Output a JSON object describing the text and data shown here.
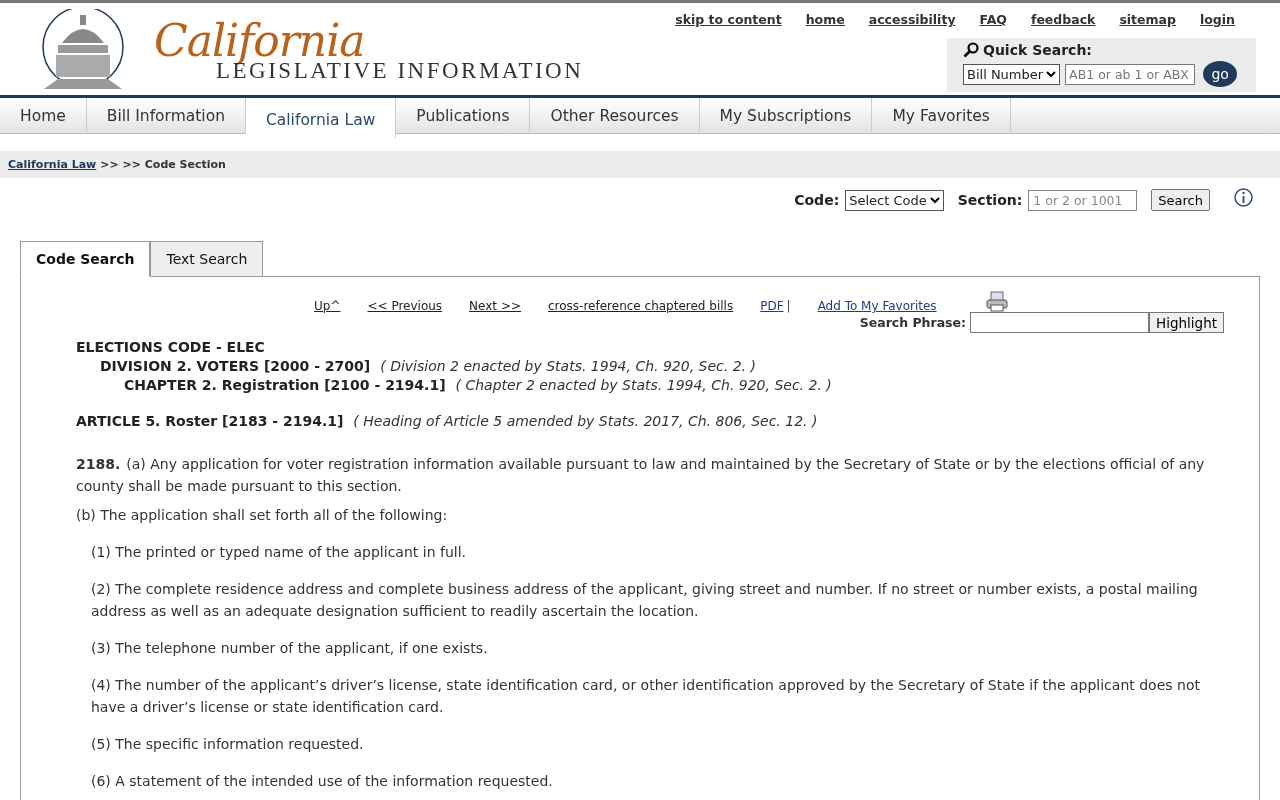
{
  "header": {
    "logo_script": "California",
    "logo_subtitle": "LEGISLATIVE INFORMATION",
    "utility_links": [
      "skip to content",
      "home",
      "accessibility",
      "FAQ",
      "feedback",
      "sitemap",
      "login"
    ],
    "quick_search": {
      "title": "Quick Search:",
      "select_value": "Bill Number",
      "placeholder": "AB1 or ab 1 or ABX",
      "button": "go"
    }
  },
  "nav": [
    {
      "label": "Home",
      "selected": false
    },
    {
      "label": "Bill Information",
      "selected": false
    },
    {
      "label": "California Law",
      "selected": true
    },
    {
      "label": "Publications",
      "selected": false
    },
    {
      "label": "Other Resources",
      "selected": false
    },
    {
      "label": "My Subscriptions",
      "selected": false
    },
    {
      "label": "My Favorites",
      "selected": false
    }
  ],
  "breadcrumb": {
    "link": "California Law",
    "rest": ">> >> Code Section"
  },
  "code_search": {
    "code_label": "Code:",
    "code_select": "Select Code",
    "section_label": "Section:",
    "section_placeholder": "1 or 2 or 1001",
    "button": "Search"
  },
  "tabs": [
    {
      "label": "Code Search",
      "selected": true
    },
    {
      "label": "Text Search",
      "selected": false
    }
  ],
  "doc_links": [
    {
      "label": "Up^",
      "kind": "plain"
    },
    {
      "label": "<< Previous",
      "kind": "plain"
    },
    {
      "label": "Next >>",
      "kind": "plain"
    },
    {
      "label": "cross-reference chaptered bills",
      "kind": "plain"
    },
    {
      "label": "PDF",
      "kind": "blue"
    },
    {
      "label": "Add To My Favorites",
      "kind": "blue"
    }
  ],
  "doc_separator": "|",
  "phrase_search": {
    "label": "Search Phrase:",
    "button": "Highlight"
  },
  "headings": [
    {
      "title": "ELECTIONS CODE - ELEC",
      "children": [
        {
          "title": "DIVISION 2. VOTERS [2000 - 2700]",
          "note": "( Division 2 enacted by Stats. 1994, Ch. 920, Sec. 2. )",
          "children": [
            {
              "title": "CHAPTER 2. Registration [2100 - 2194.1]",
              "note": "( Chapter 2 enacted by Stats. 1994, Ch. 920, Sec. 2. )"
            }
          ]
        }
      ]
    }
  ],
  "article": {
    "title": "ARTICLE 5. Roster [2183 - 2194.1]",
    "note": "( Heading of Article 5 amended by Stats. 2017, Ch. 806, Sec. 12. )"
  },
  "section": {
    "number": "2188.",
    "paragraphs": [
      {
        "text": "(a) Any application for voter registration information available pursuant to law and maintained by the Secretary of State or by the elections official of any county shall be made pursuant to this section.",
        "kind": "lead"
      },
      {
        "text": "(b) The application shall set forth all of the following:",
        "kind": "top"
      },
      {
        "text": "(1) The printed or typed name of the applicant in full.",
        "kind": "item"
      },
      {
        "text": "(2) The complete residence address and complete business address of the applicant, giving street and number. If no street or number exists, a postal mailing address as well as an adequate designation sufficient to readily ascertain the location.",
        "kind": "item"
      },
      {
        "text": "(3) The telephone number of the applicant, if one exists.",
        "kind": "item"
      },
      {
        "text": "(4) The number of the applicant’s driver’s license, state identification card, or other identification approved by the Secretary of State if the applicant does not have a driver’s license or state identification card.",
        "kind": "item"
      },
      {
        "text": "(5) The specific information requested.",
        "kind": "item"
      },
      {
        "text": "(6) A statement of the intended use of the information requested.",
        "kind": "item"
      }
    ]
  }
}
